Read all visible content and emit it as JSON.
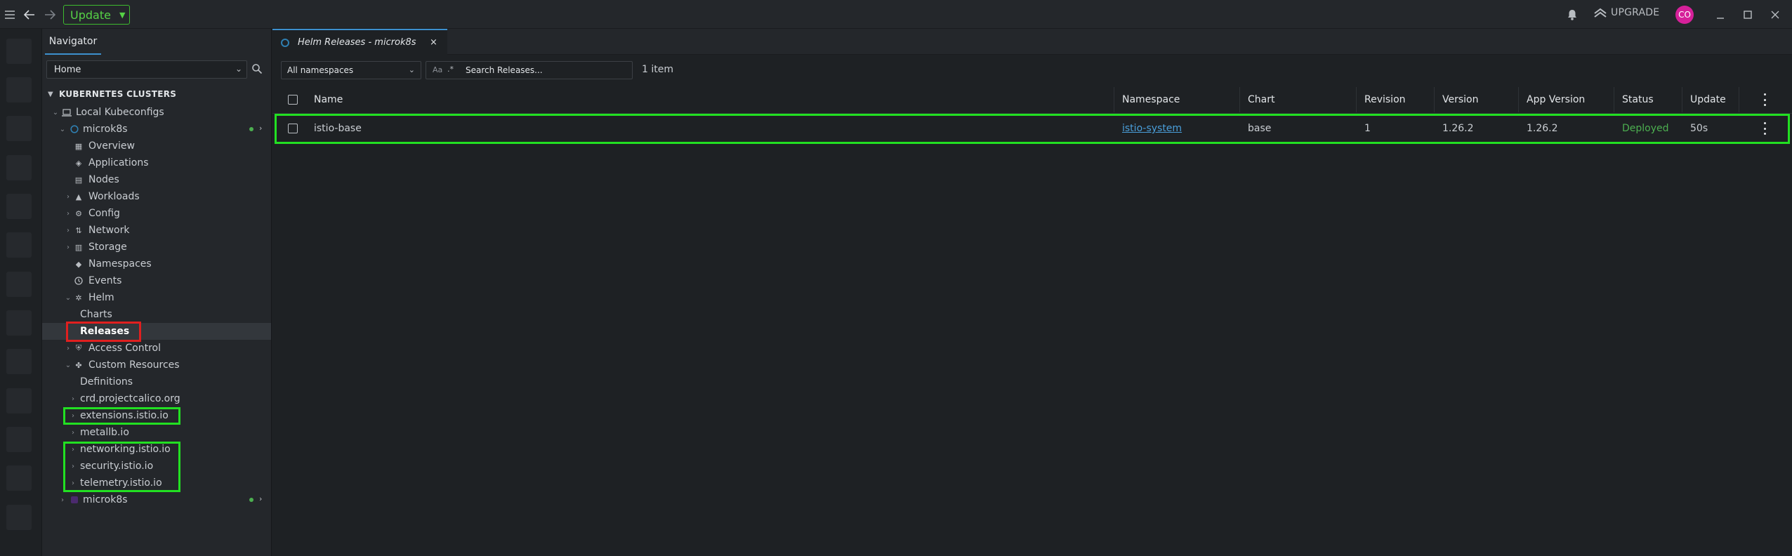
{
  "topbar": {
    "update_label": "Update",
    "upgrade_label": "UPGRADE",
    "avatar_initials": "CO"
  },
  "sidebar": {
    "tab_label": "Navigator",
    "home_select_value": "Home",
    "clusters_header": "KUBERNETES CLUSTERS",
    "tree": {
      "local_kubeconfigs": "Local Kubeconfigs",
      "cluster1": "microk8s",
      "overview": "Overview",
      "applications": "Applications",
      "nodes": "Nodes",
      "workloads": "Workloads",
      "config": "Config",
      "network": "Network",
      "storage": "Storage",
      "namespaces": "Namespaces",
      "events": "Events",
      "helm": "Helm",
      "charts": "Charts",
      "releases": "Releases",
      "access_control": "Access Control",
      "custom_resources": "Custom Resources",
      "definitions": "Definitions",
      "crd_projectcalico": "crd.projectcalico.org",
      "extensions_istio": "extensions.istio.io",
      "metallb": "metallb.io",
      "networking_istio": "networking.istio.io",
      "security_istio": "security.istio.io",
      "telemetry_istio": "telemetry.istio.io",
      "cluster2": "microk8s"
    }
  },
  "main": {
    "tab_title": "Helm Releases - microk8s",
    "tab_close": "×",
    "namespace_select_value": "All namespaces",
    "search_case_label": "Aa",
    "search_regex_label": ".*",
    "search_placeholder": "Search Releases...",
    "items_count": "1 item",
    "columns": {
      "name": "Name",
      "namespace": "Namespace",
      "chart": "Chart",
      "revision": "Revision",
      "version": "Version",
      "app_version": "App Version",
      "status": "Status",
      "updated": "Update"
    },
    "rows": [
      {
        "name": "istio-base",
        "namespace": "istio-system",
        "chart": "base",
        "revision": "1",
        "version": "1.26.2",
        "app_version": "1.26.2",
        "status": "Deployed",
        "updated": "50s"
      }
    ]
  }
}
